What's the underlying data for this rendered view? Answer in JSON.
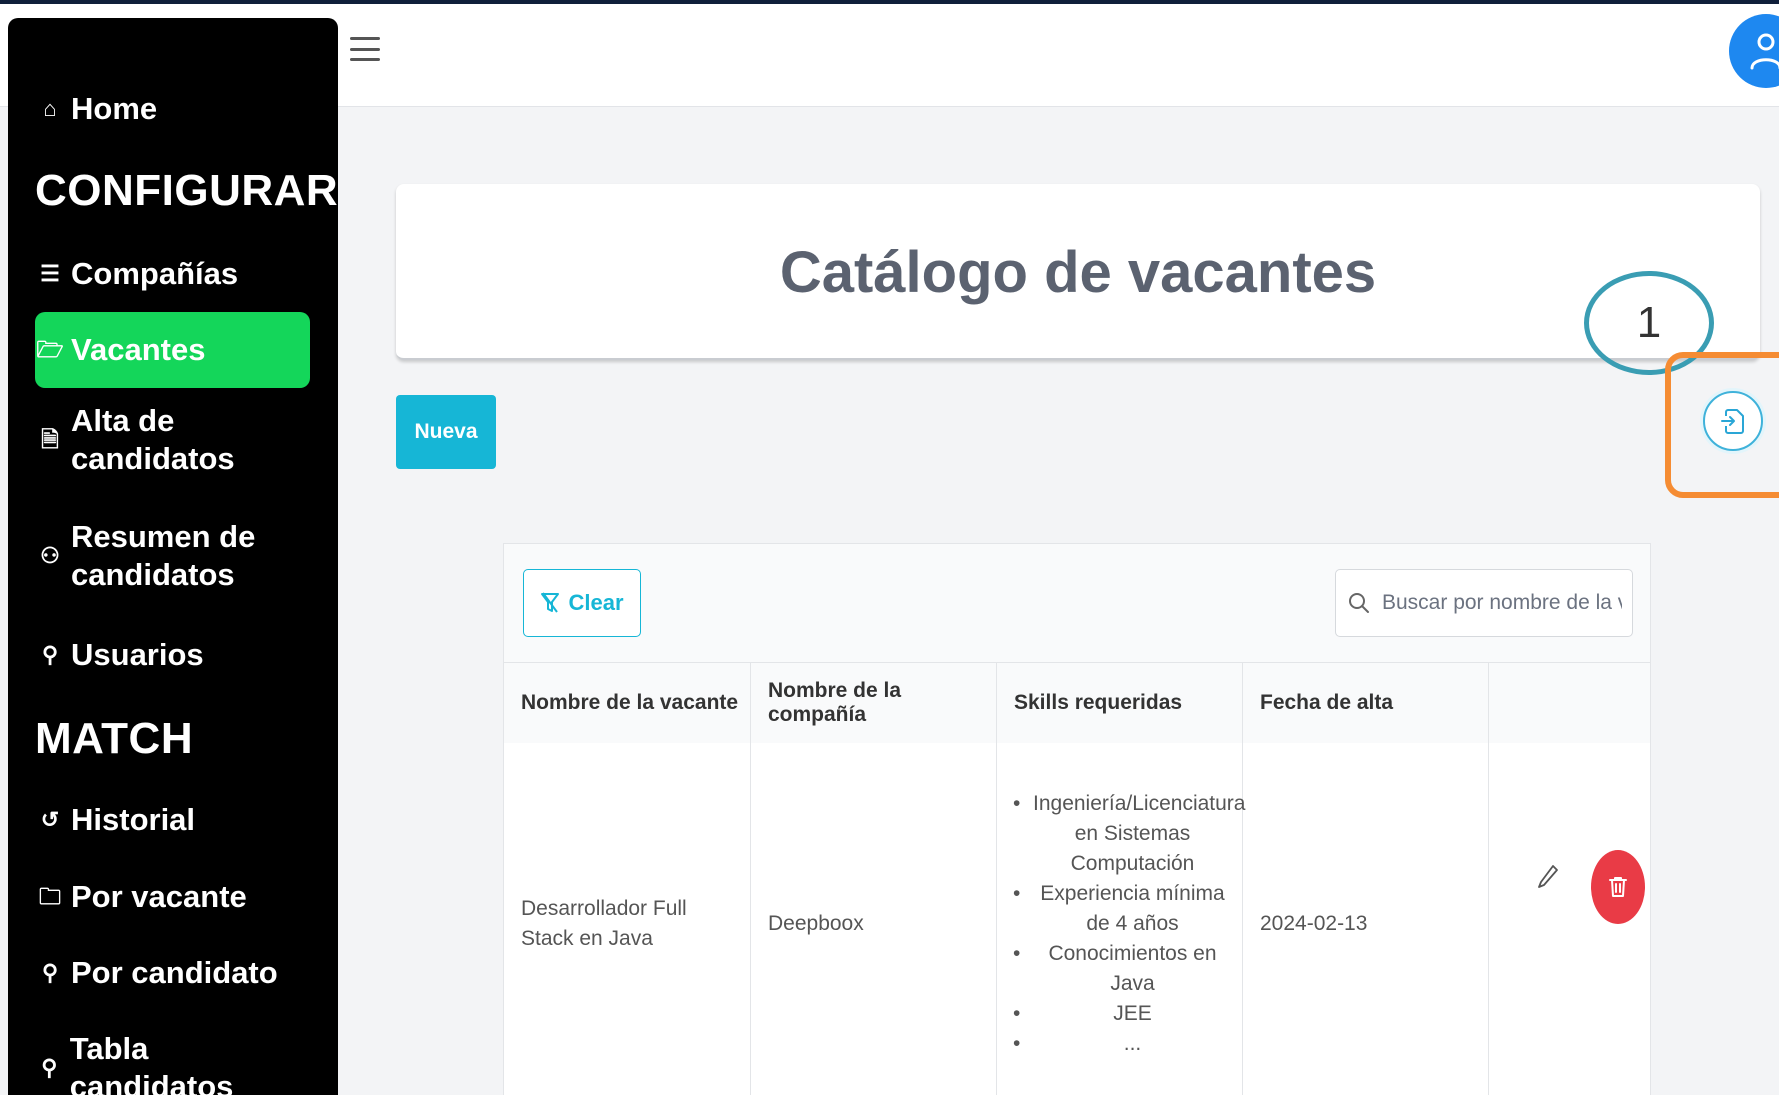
{
  "sidebar": {
    "home_label": "Home",
    "section_configurar": "CONFIGURAR",
    "companias_label": "Compañías",
    "vacantes_label": "Vacantes",
    "alta_candidatos_line1": "Alta de",
    "alta_candidatos_line2": "candidatos",
    "resumen_line1": "Resumen de",
    "resumen_line2": "candidatos",
    "usuarios_label": "Usuarios",
    "section_match": "MATCH",
    "historial_label": "Historial",
    "por_vacante_label": "Por vacante",
    "por_candidato_label": "Por candidato",
    "tabla_candidatos_label": "Tabla candidatos",
    "active_color": "#14d65a"
  },
  "page": {
    "title": "Catálogo de vacantes",
    "new_button": "Nueva",
    "annotation_number": "1"
  },
  "table": {
    "clear_button": "Clear",
    "search_placeholder": "Buscar por nombre de la vac",
    "columns": [
      "Nombre de la vacante",
      "Nombre de la compañía",
      "Skills requeridas",
      "Fecha de alta",
      ""
    ],
    "rows": [
      {
        "vacante": "Desarrollador Full Stack en Java",
        "compania": "Deepboox",
        "skills": [
          "Ingeniería/Licenciatura en Sistemas Computación",
          "Experiencia mínima de 4 años",
          "Conocimientos en Java",
          "JEE",
          "..."
        ],
        "fecha": "2024-02-13"
      }
    ]
  },
  "colors": {
    "accent": "#16b6d6",
    "danger": "#e93b46",
    "annotation_circle": "#3a9db3",
    "annotation_box": "#f58c33"
  }
}
